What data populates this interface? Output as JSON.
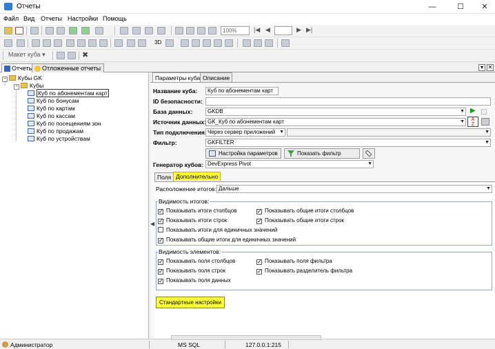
{
  "window": {
    "title": "Отчеты",
    "controls": {
      "minimize": "—",
      "maximize": "☐",
      "close": "✕"
    }
  },
  "menu": [
    "Файл",
    "Вид",
    "Отчеты",
    "Настройки",
    "Помощь"
  ],
  "toolbar": {
    "zoom": "100%",
    "cube_layout_label": "Макет куба",
    "threed_label": "3D"
  },
  "doc_tabs": {
    "reports": "Отчеты",
    "deferred": "Отложенные отчеты"
  },
  "tree": {
    "root": "Кубы GK",
    "folder": "Кубы",
    "cubes": [
      "Куб по абонементам карт",
      "Куб по бонусам",
      "Куб по картам",
      "Куб по кассам",
      "Куб по посещениям зон",
      "Куб по продажам",
      "Куб по устройствам"
    ],
    "selected_index": 0
  },
  "right_tabs": [
    "Параметры куба",
    "Описание"
  ],
  "form": {
    "cube_name": {
      "label": "Название куба:",
      "value": "Куб по абонементам карт"
    },
    "security_id": {
      "label": "ID безопасности:",
      "value": ""
    },
    "database": {
      "label": "База данных:",
      "value": "GKDB"
    },
    "data_source": {
      "label": "Источник данных:",
      "value": "GK_Куб по абонементам карт"
    },
    "connection_type": {
      "label": "Тип подключения:",
      "value": "Через сервер приложений"
    },
    "filter": {
      "label": "Фильтр:",
      "value": "GKFILTER"
    },
    "param_settings_button": "Настройка параметров",
    "show_filter_button": "Показать фильтр",
    "cube_generator": {
      "label": "Генератор кубов:",
      "value": "DevExpress Pivot"
    }
  },
  "sub_tabs": [
    "Поля",
    "Дополнительно"
  ],
  "totals_location": {
    "label": "Расположение итогов:",
    "value": "Дальше"
  },
  "totals_visibility": {
    "title": "Видимость итогов:",
    "items": [
      {
        "label": "Показывать итоги столбцов",
        "checked": true
      },
      {
        "label": "Показывать общие итоги столбцов",
        "checked": true
      },
      {
        "label": "Показывать итоги строк",
        "checked": true
      },
      {
        "label": "Показывать общие итоги строк",
        "checked": true
      },
      {
        "label": "Показывать итоги для единичных значений",
        "checked": false
      },
      {
        "label": "Показывать общие итоги для единичных значений",
        "checked": true
      }
    ]
  },
  "elements_visibility": {
    "title": "Видимость элементов:",
    "items": [
      {
        "label": "Показывать поля столбцов",
        "checked": true
      },
      {
        "label": "Показывать поля фильтра",
        "checked": true
      },
      {
        "label": "Показывать поля строк",
        "checked": true
      },
      {
        "label": "Показывать разделитель фильтра",
        "checked": true
      },
      {
        "label": "Показывать поля данных",
        "checked": true
      }
    ]
  },
  "standard_settings_button": "Стандартные настройки",
  "status": {
    "user": "Администратор",
    "db": "MS SQL",
    "server": "127.0.0.1:215"
  },
  "colors": {
    "highlight": "#ffff3a",
    "group_border": "#8fa7d6",
    "accent": "#2f7fd6"
  }
}
